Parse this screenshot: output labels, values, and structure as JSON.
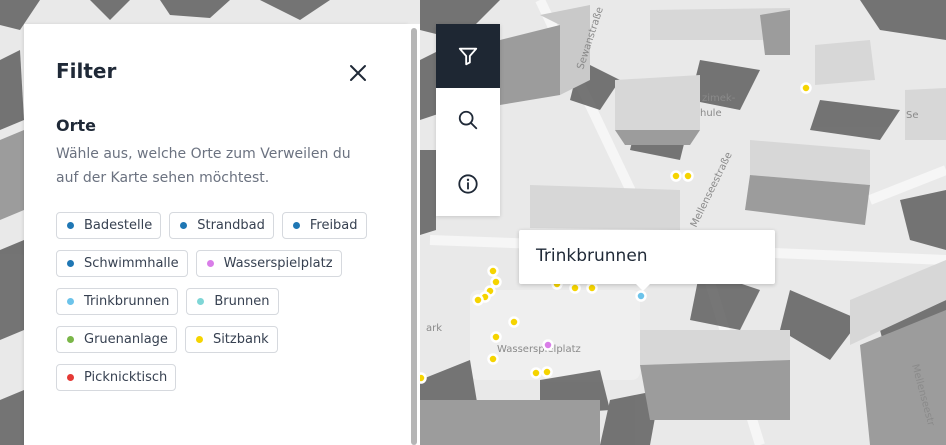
{
  "filter_panel": {
    "title": "Filter",
    "section_title": "Orte",
    "section_description": "Wähle aus, welche Orte zum Verweilen du auf der Karte sehen möchtest.",
    "categories": [
      {
        "label": "Badestelle",
        "color": "#1f77b4"
      },
      {
        "label": "Strandbad",
        "color": "#1f77b4"
      },
      {
        "label": "Freibad",
        "color": "#1f77b4"
      },
      {
        "label": "Schwimmhalle",
        "color": "#1f77b4"
      },
      {
        "label": "Wasserspielplatz",
        "color": "#d97ee8"
      },
      {
        "label": "Trinkbrunnen",
        "color": "#6cc3ea"
      },
      {
        "label": "Brunnen",
        "color": "#7fd6d6"
      },
      {
        "label": "Gruenanlage",
        "color": "#7ab648"
      },
      {
        "label": "Sitzbank",
        "color": "#f5d400"
      },
      {
        "label": "Picknicktisch",
        "color": "#e53935"
      }
    ]
  },
  "toolbar": {
    "buttons": [
      {
        "name": "filter",
        "icon": "filter-icon",
        "active": true
      },
      {
        "name": "search",
        "icon": "search-icon",
        "active": false
      },
      {
        "name": "info",
        "icon": "info-icon",
        "active": false
      }
    ]
  },
  "tooltip": {
    "text": "Trinkbrunnen"
  },
  "map": {
    "street_labels": [
      "Sewanstraße",
      "Mellenseestraße",
      "Mellenseestr",
      "zimek-",
      "hule",
      "Wasserspielplatz",
      "ark",
      "Se"
    ],
    "colors": {
      "background": "#e9e9e9",
      "building_top": "#d7d7d7",
      "building_side": "#9c9c9c",
      "shadow": "#5f5f5f",
      "accent_dark": "#1e2733"
    }
  }
}
